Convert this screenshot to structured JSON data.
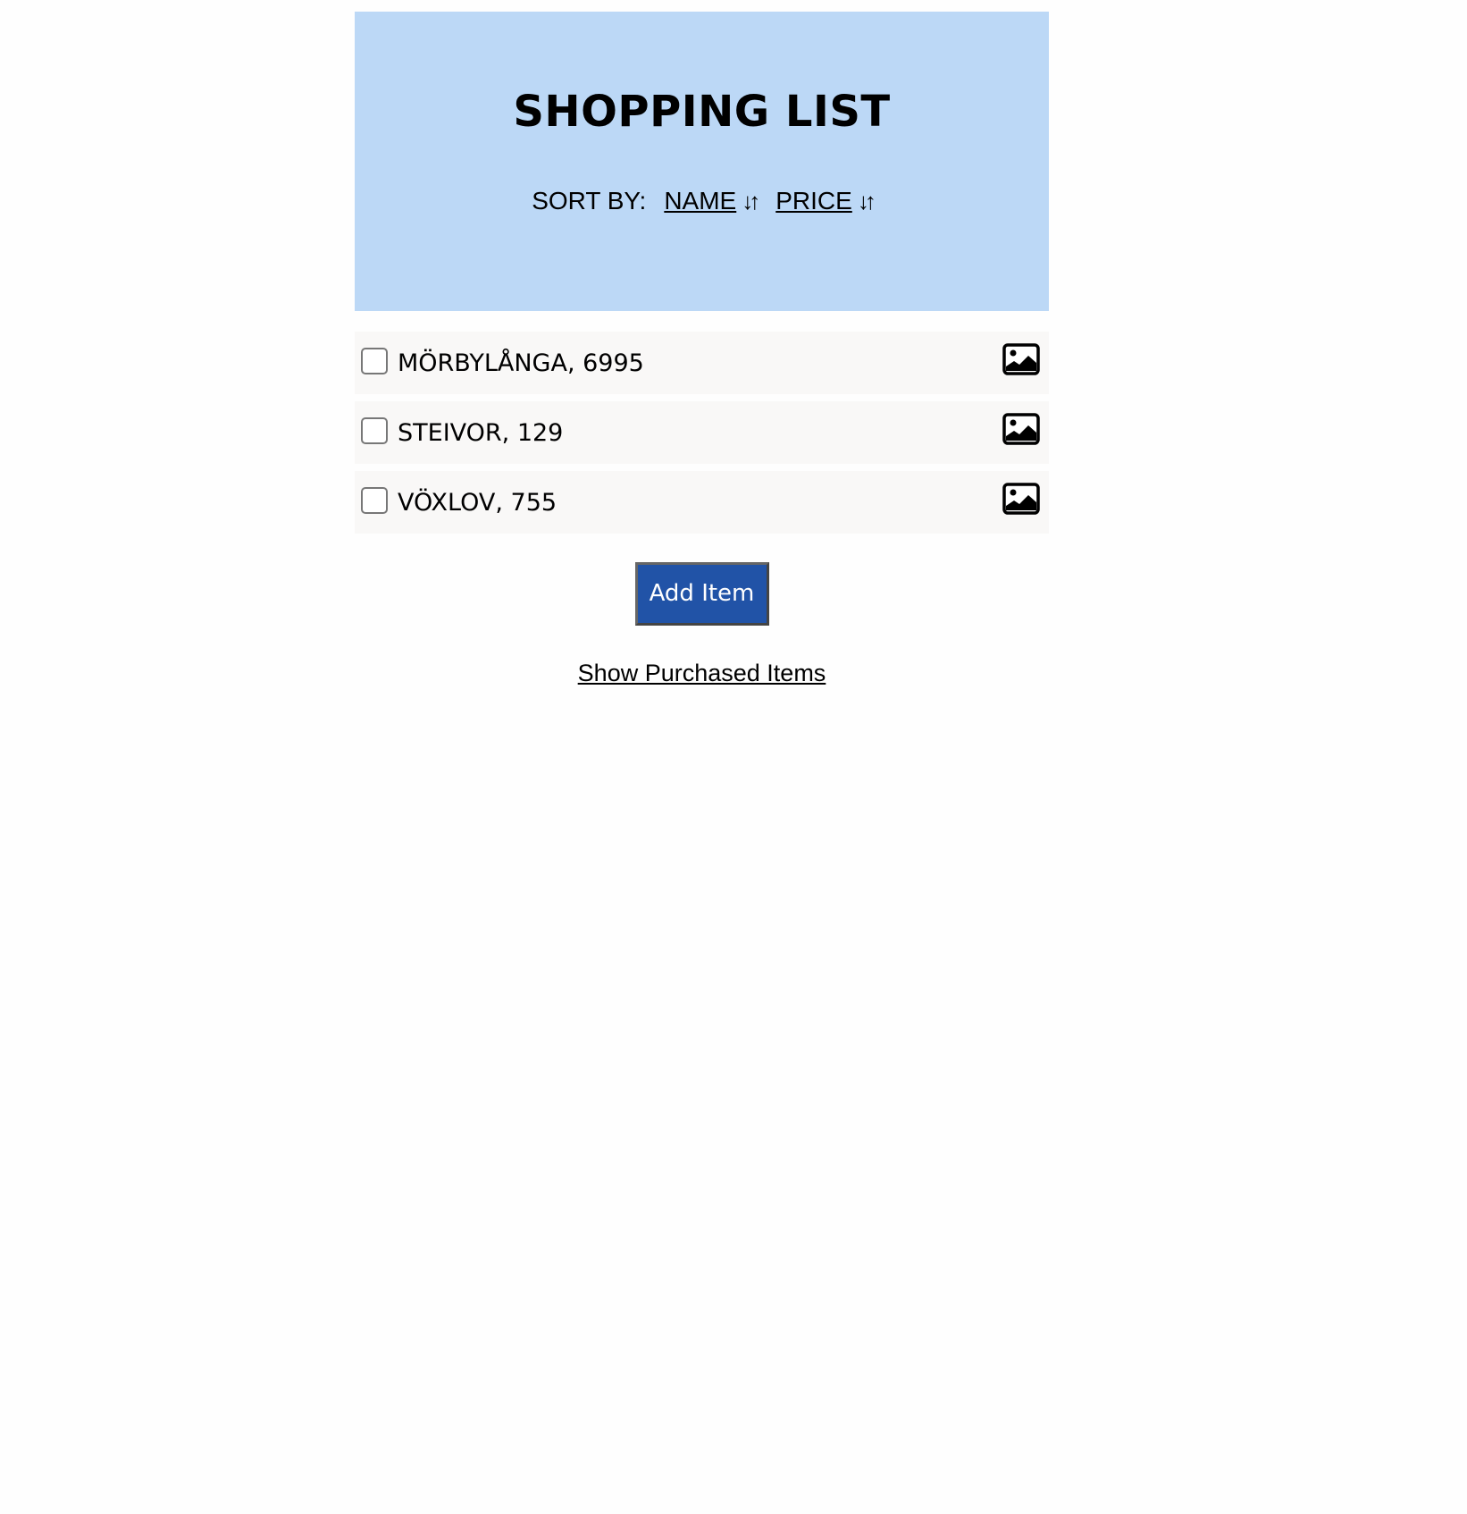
{
  "header": {
    "title": "SHOPPING LIST",
    "sort_label": "SORT BY:",
    "sort_options": [
      {
        "label": "NAME",
        "icon": "sort-arrows-icon"
      },
      {
        "label": "PRICE",
        "icon": "sort-arrows-icon"
      }
    ]
  },
  "items": [
    {
      "text": "MÖRBYLÅNGA, 6995",
      "checked": false,
      "icon": "image-icon"
    },
    {
      "text": "STEIVOR, 129",
      "checked": false,
      "icon": "image-icon"
    },
    {
      "text": "VÖXLOV, 755",
      "checked": false,
      "icon": "image-icon"
    }
  ],
  "actions": {
    "add_label": "Add Item",
    "show_purchased_label": "Show Purchased Items"
  },
  "colors": {
    "header_bg": "#bcd8f6",
    "item_bg": "#f9f8f7",
    "button_bg": "#2153a7"
  }
}
